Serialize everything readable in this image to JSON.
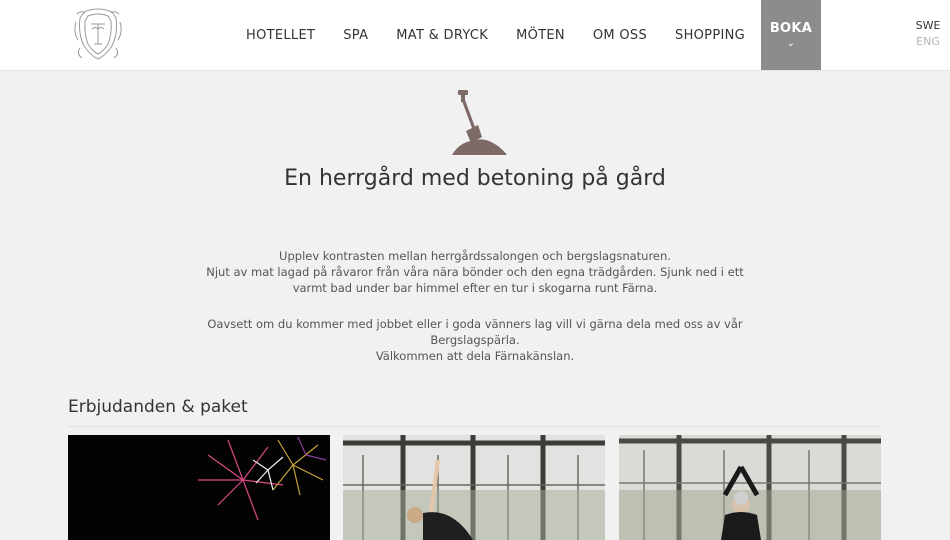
{
  "nav": {
    "items": [
      {
        "label": "HOTELLET"
      },
      {
        "label": "SPA"
      },
      {
        "label": "MAT & DRYCK"
      },
      {
        "label": "MÖTEN"
      },
      {
        "label": "OM OSS"
      },
      {
        "label": "SHOPPING"
      }
    ],
    "boka_label": "BOKA",
    "boka_chevron": "⌄"
  },
  "language": {
    "current": "SWE",
    "other": "ENG"
  },
  "intro": {
    "title": "En herrgård med betoning på gård",
    "paragraph1": [
      "Upplev kontrasten mellan herrgårdssalongen och bergslagsnaturen.",
      "Njut av mat lagad på råvaror från våra nära bönder och den egna trädgården. Sjunk ned i ett",
      "varmt bad under bar himmel efter en tur i skogarna runt Färna."
    ],
    "paragraph2": [
      "Oavsett om du kommer med jobbet eller i goda vänners lag vill vi gärna dela med oss av vår Bergslagspärla.",
      "Välkommen att dela Färnakänslan."
    ]
  },
  "offers": {
    "title": "Erbjudanden & paket",
    "cards": [
      {
        "image": "fireworks-image"
      },
      {
        "image": "yoga-side-stretch-image"
      },
      {
        "image": "yoga-arms-raised-image"
      }
    ]
  },
  "colors": {
    "header_bg": "#ffffff",
    "page_bg": "#f1f1f1",
    "boka_bg": "#8c8c8c",
    "text": "#333333",
    "muted": "#b5b5b5",
    "shovel": "#7d6a66"
  }
}
